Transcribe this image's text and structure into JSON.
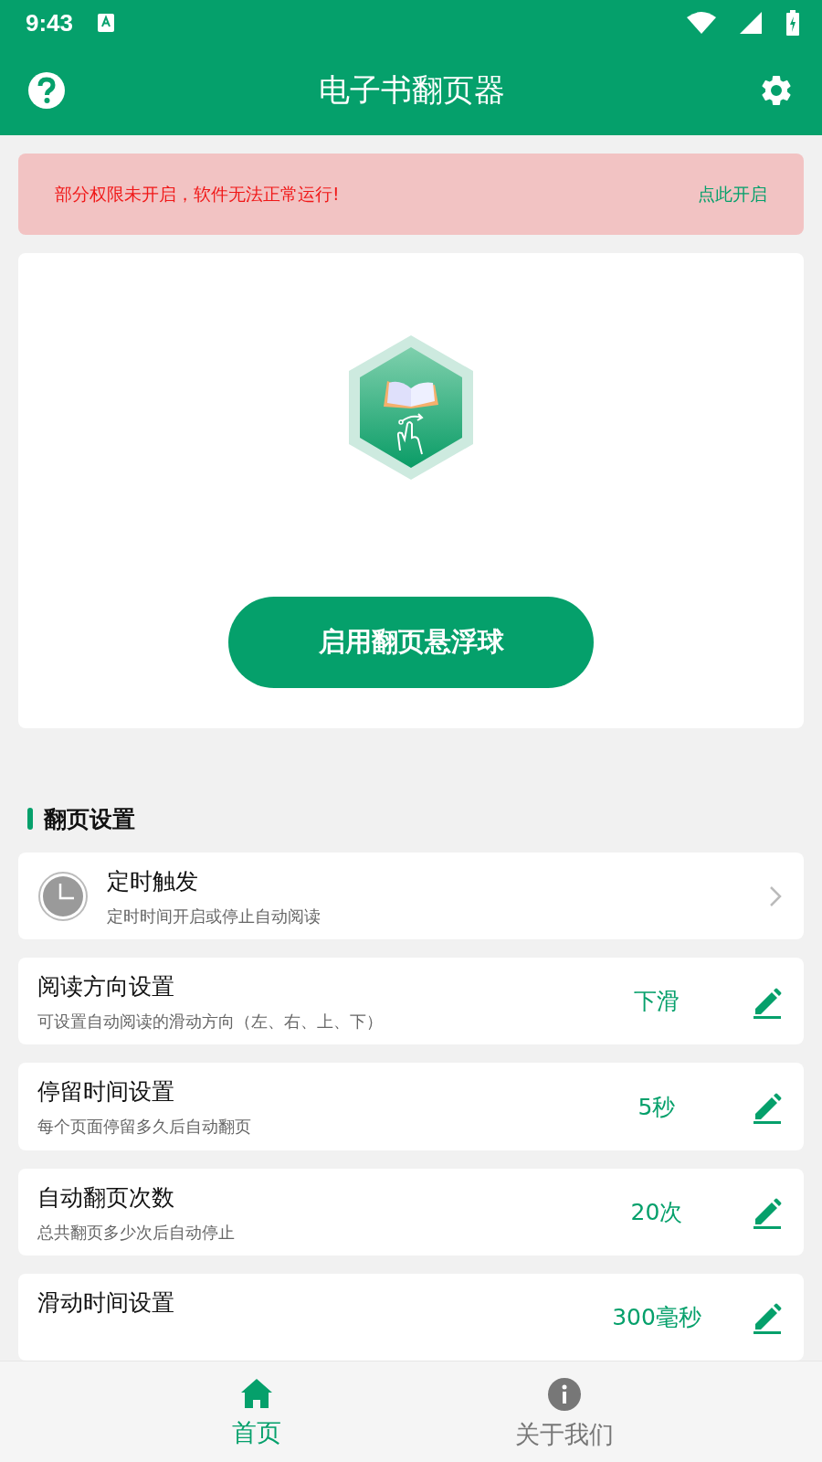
{
  "status_bar": {
    "time": "9:43"
  },
  "app_bar": {
    "title": "电子书翻页器"
  },
  "warning": {
    "message": "部分权限未开启，软件无法正常运行!",
    "action": "点此开启"
  },
  "main_card": {
    "button": "启用翻页悬浮球"
  },
  "section": {
    "title": "翻页设置"
  },
  "settings": [
    {
      "kind": "link",
      "title": "定时触发",
      "subtitle": "定时时间开启或停止自动阅读"
    },
    {
      "kind": "edit",
      "title": "阅读方向设置",
      "subtitle": "可设置自动阅读的滑动方向（左、右、上、下）",
      "value": "下滑"
    },
    {
      "kind": "edit",
      "title": "停留时间设置",
      "subtitle": "每个页面停留多久后自动翻页",
      "value": "5秒"
    },
    {
      "kind": "edit",
      "title": "自动翻页次数",
      "subtitle": "总共翻页多少次后自动停止",
      "value": "20次"
    },
    {
      "kind": "edit",
      "title": "滑动时间设置",
      "value": "300毫秒"
    }
  ],
  "bottom_nav": [
    {
      "kind": "home",
      "label": "首页",
      "selected": true
    },
    {
      "kind": "info",
      "label": "关于我们",
      "selected": false
    }
  ]
}
